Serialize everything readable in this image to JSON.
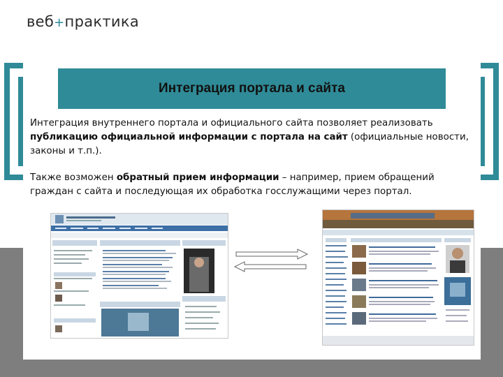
{
  "logo": {
    "part1": "веб",
    "plus": "+",
    "part2": "практика"
  },
  "slide": {
    "title": "Интеграция портала и сайта",
    "p1_a": "Интеграция внутреннего портала и официального сайта позволяет реализовать ",
    "p1_b": "публикацию официальной информации с портала на сайт",
    "p1_c": " (официальные новости, законы и т.п.).",
    "p2_a": "Также возможен ",
    "p2_b": "обратный прием информации",
    "p2_c": " – например, прием обращений граждан с сайта и последующая их обработка госслужащими через портал."
  },
  "colors": {
    "accent": "#2f8b97",
    "gray_band": "#7e7e7e",
    "portal_nav": "#3c6fa6"
  }
}
